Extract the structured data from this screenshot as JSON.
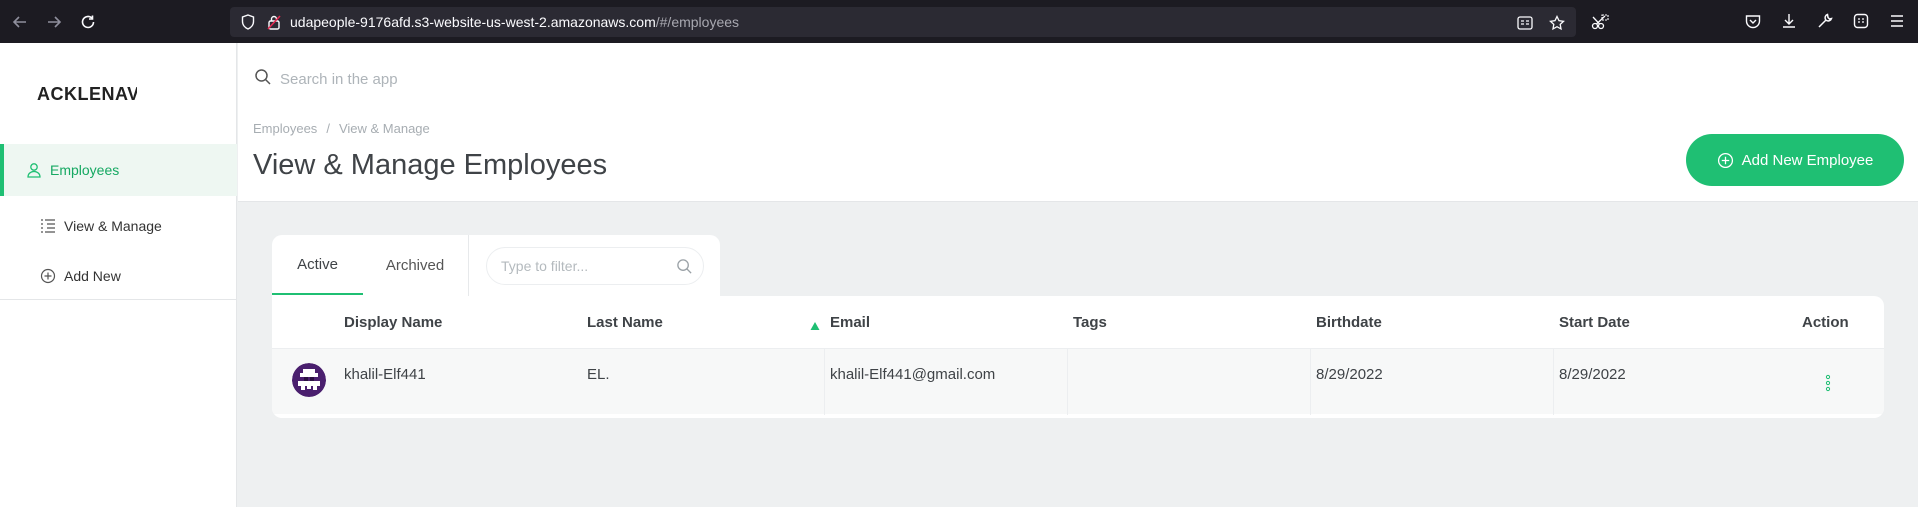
{
  "browser": {
    "url_host": "udapeople-9176afd.s3-website-us-west-2.amazonaws.com",
    "url_path": "/#/employees"
  },
  "sidebar": {
    "logo": "ACKLENAVENUE",
    "items": [
      {
        "label": "Employees",
        "icon": "user-icon",
        "active": true
      },
      {
        "label": "View & Manage",
        "icon": "list-icon",
        "active": false
      },
      {
        "label": "Add New",
        "icon": "plus-circle-icon",
        "active": false
      }
    ]
  },
  "header": {
    "search_placeholder": "Search in the app",
    "breadcrumb": [
      "Employees",
      "View & Manage"
    ],
    "breadcrumb_sep": "/",
    "title": "View & Manage Employees",
    "add_button": "Add New Employee"
  },
  "tabs": {
    "items": [
      "Active",
      "Archived"
    ],
    "active": "Active",
    "filter_placeholder": "Type to filter..."
  },
  "table": {
    "columns": [
      "Display Name",
      "Last Name",
      "Email",
      "Tags",
      "Birthdate",
      "Start Date",
      "Action"
    ],
    "sorted_column": "Email",
    "rows": [
      {
        "display_name": "khalil-Elf441",
        "last_name": "EL.",
        "email": "khalil-Elf441@gmail.com",
        "tags": "",
        "birthdate": "8/29/2022",
        "start_date": "8/29/2022"
      }
    ]
  },
  "colors": {
    "accent": "#1fbf73",
    "browser_bg": "#1c1b22",
    "page_bg": "#eef0f1"
  }
}
